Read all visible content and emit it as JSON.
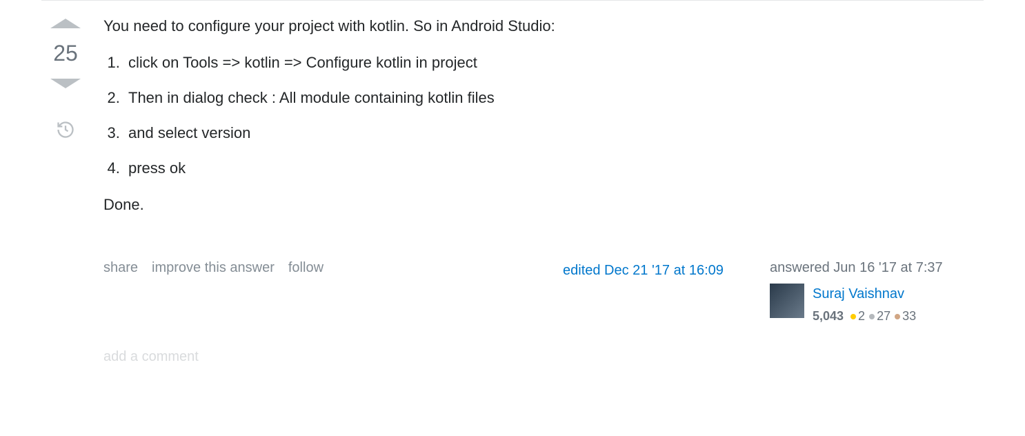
{
  "vote": {
    "count": "25"
  },
  "body": {
    "intro": "You need to configure your project with kotlin. So in Android Studio:",
    "steps": [
      "click on Tools => kotlin => Configure kotlin in project",
      "Then in dialog check : All module containing kotlin files",
      "and select version",
      "press ok"
    ],
    "outro": "Done."
  },
  "actions": {
    "share": "share",
    "improve": "improve this answer",
    "follow": "follow"
  },
  "edited": {
    "label": "edited Dec 21 '17 at 16:09"
  },
  "answered": {
    "label": "answered Jun 16 '17 at 7:37",
    "user": {
      "name": "Suraj Vaishnav",
      "reputation": "5,043",
      "gold": "2",
      "silver": "27",
      "bronze": "33"
    }
  },
  "add_comment": "add a comment"
}
